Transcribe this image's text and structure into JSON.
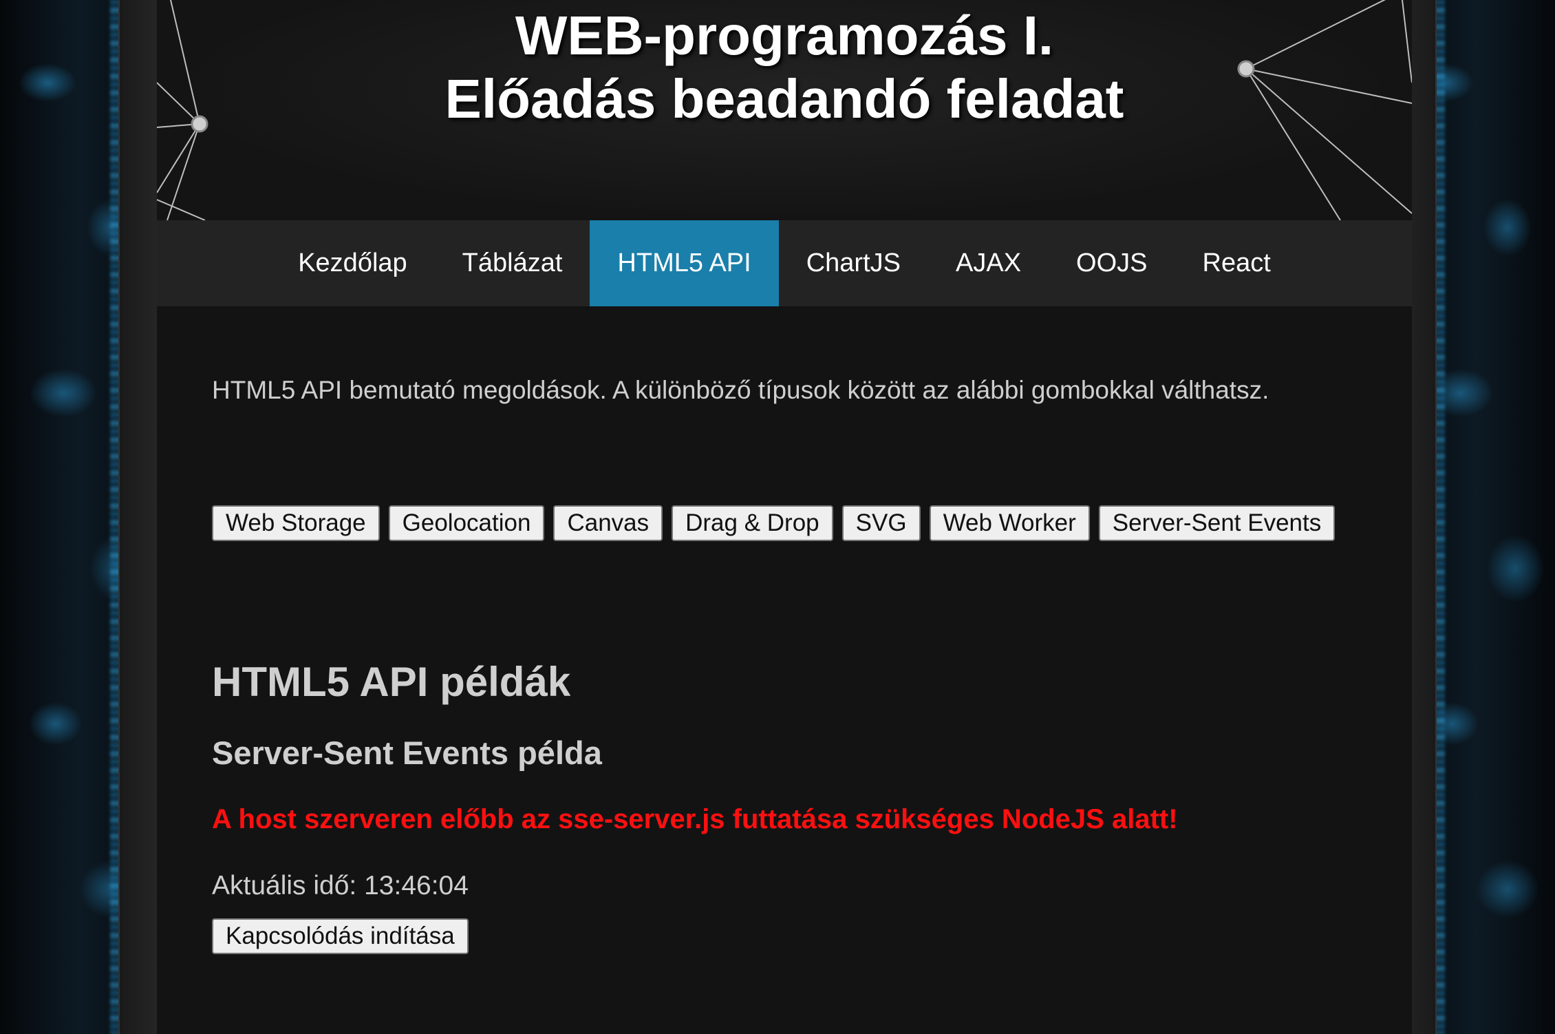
{
  "header": {
    "title_line1": "WEB-programozás I.",
    "title_line2": "Előadás beadandó feladat"
  },
  "nav": {
    "items": [
      {
        "label": "Kezdőlap",
        "active": false
      },
      {
        "label": "Táblázat",
        "active": false
      },
      {
        "label": "HTML5 API",
        "active": true
      },
      {
        "label": "ChartJS",
        "active": false
      },
      {
        "label": "AJAX",
        "active": false
      },
      {
        "label": "OOJS",
        "active": false
      },
      {
        "label": "React",
        "active": false
      }
    ]
  },
  "main": {
    "intro": "HTML5 API bemutató megoldások. A különböző típusok között az alábbi gombokkal válthatsz.",
    "buttons": [
      "Web Storage",
      "Geolocation",
      "Canvas",
      "Drag & Drop",
      "SVG",
      "Web Worker",
      "Server-Sent Events"
    ],
    "section_title": "HTML5 API példák",
    "subsection_title": "Server-Sent Events példa",
    "warning": "A host szerveren előbb az sse-server.js futtatása szükséges NodeJS alatt!",
    "time_label": "Aktuális idő: 13:46:04",
    "connect_button": "Kapcsolódás indítása"
  },
  "colors": {
    "nav_active": "#1a7faa",
    "warning": "#ff1010",
    "accent_side": "#2896d2"
  }
}
